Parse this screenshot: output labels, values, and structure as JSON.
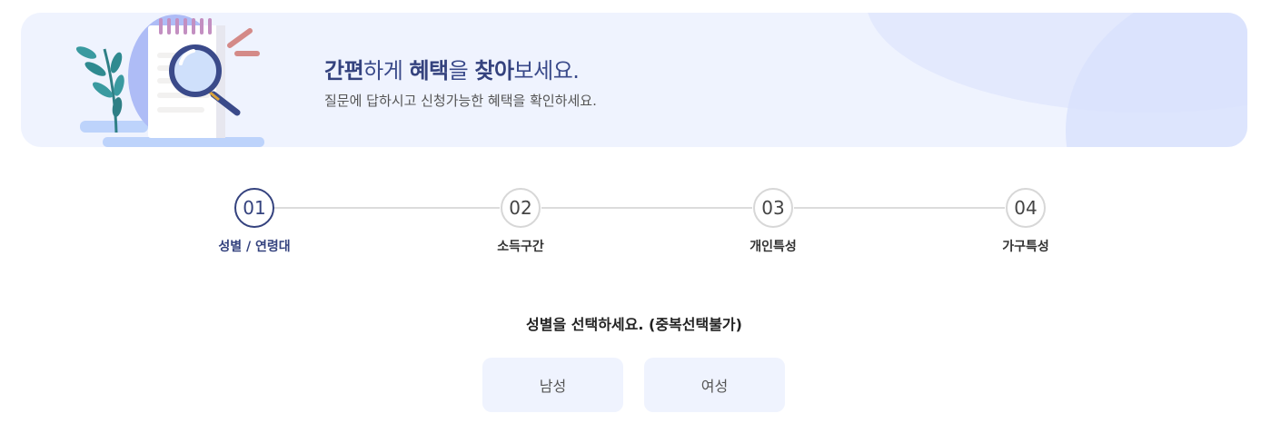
{
  "banner": {
    "headline_parts": [
      {
        "text": "간편",
        "bold": true
      },
      {
        "text": "하게 ",
        "bold": false
      },
      {
        "text": "혜택",
        "bold": true
      },
      {
        "text": "을 ",
        "bold": false
      },
      {
        "text": "찾아",
        "bold": true
      },
      {
        "text": "보세요.",
        "bold": false
      }
    ],
    "subline": "질문에 답하시고 신청가능한 혜택을 확인하세요.",
    "illustration_icon": "notepad-magnifier-illustration"
  },
  "steps": [
    {
      "number": "01",
      "label": "성별 / 연령대",
      "active": true
    },
    {
      "number": "02",
      "label": "소득구간",
      "active": false
    },
    {
      "number": "03",
      "label": "개인특성",
      "active": false
    },
    {
      "number": "04",
      "label": "가구특성",
      "active": false
    }
  ],
  "question": {
    "text": "성별을 선택하세요. (중복선택불가)",
    "options": [
      "남성",
      "여성"
    ]
  },
  "colors": {
    "accent": "#34427e",
    "banner_bg": "#eff3fe",
    "option_bg": "#eff3fe"
  }
}
